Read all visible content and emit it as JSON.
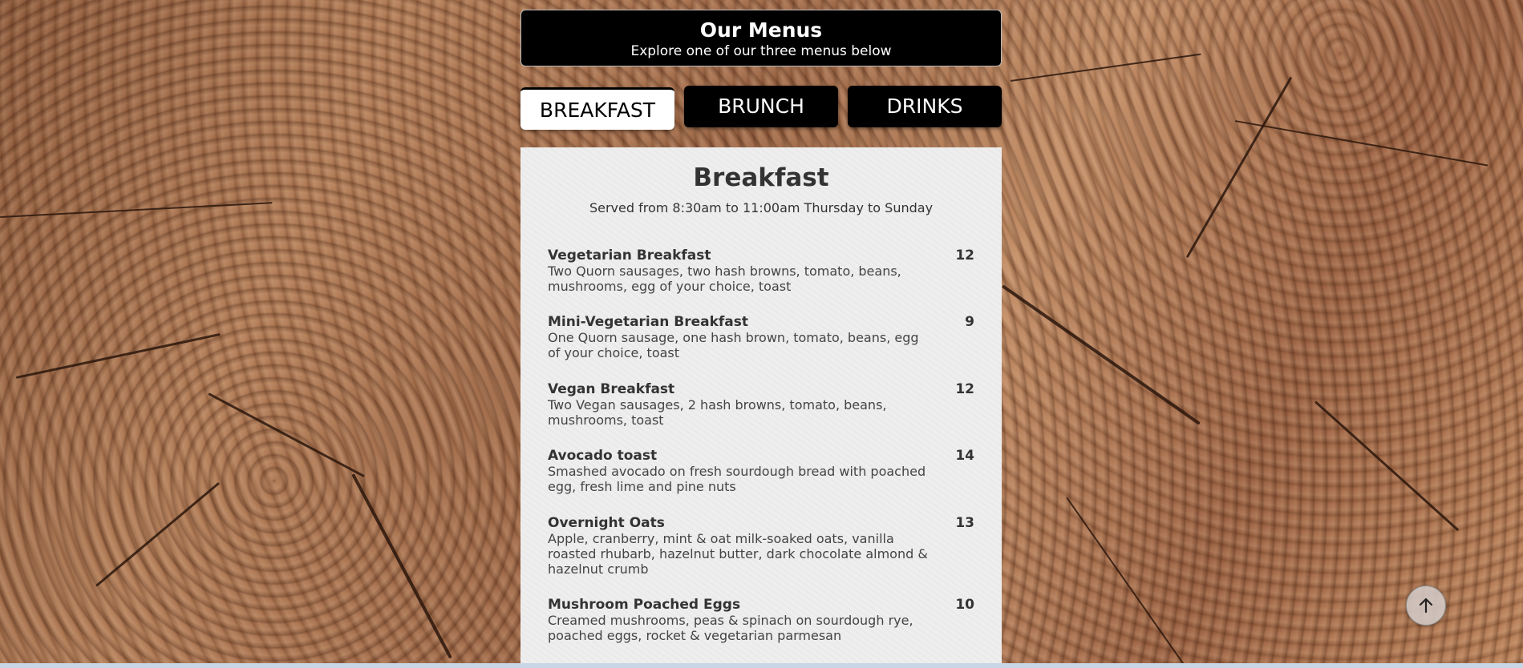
{
  "header": {
    "title": "Our Menus",
    "subtitle": "Explore one of our three menus below"
  },
  "tabs": [
    {
      "label": "BREAKFAST",
      "active": true
    },
    {
      "label": "BRUNCH",
      "active": false
    },
    {
      "label": "DRINKS",
      "active": false
    }
  ],
  "menu": {
    "title": "Breakfast",
    "subtitle": "Served from 8:30am to 11:00am Thursday to Sunday",
    "items": [
      {
        "name": "Vegetarian Breakfast",
        "price": "12",
        "description": "Two Quorn sausages, two hash browns, tomato, beans, mushrooms, egg of your choice, toast"
      },
      {
        "name": "Mini-Vegetarian Breakfast",
        "price": "9",
        "description": "One Quorn sausage, one hash brown, tomato, beans, egg of your choice, toast"
      },
      {
        "name": "Vegan Breakfast",
        "price": "12",
        "description": "Two Vegan sausages, 2 hash browns, tomato, beans, mushrooms, toast"
      },
      {
        "name": "Avocado toast",
        "price": "14",
        "description": "Smashed avocado on fresh sourdough bread with poached egg, fresh lime and pine nuts"
      },
      {
        "name": "Overnight Oats",
        "price": "13",
        "description": "Apple, cranberry, mint & oat milk-soaked oats, vanilla roasted rhubarb, hazelnut butter, dark chocolate almond & hazelnut crumb"
      },
      {
        "name": "Mushroom Poached Eggs",
        "price": "10",
        "description": "Creamed mushrooms, peas & spinach on sourdough rye, poached eggs, rocket & vegetarian parmesan"
      }
    ]
  },
  "icons": {
    "back_to_top": "arrow-up-icon"
  },
  "colors": {
    "header_bg": "#000000",
    "panel_bg": "#eeeeee",
    "active_tab_bg": "#ffffff"
  }
}
